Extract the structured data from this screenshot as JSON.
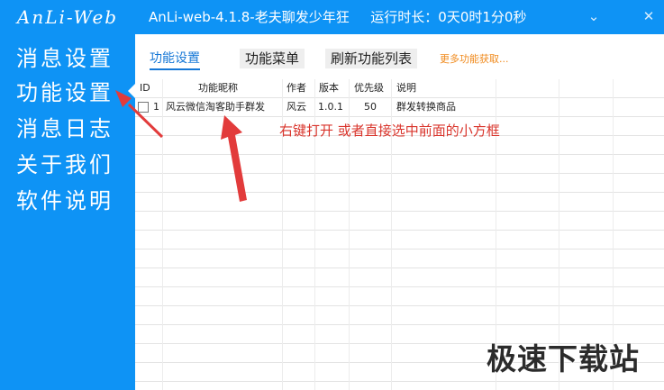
{
  "app": {
    "logo": "AnLi-Web",
    "title": "AnLi-web-4.1.8-老夫聊发少年狂",
    "runtime_label": "运行时长：0天0时1分0秒"
  },
  "window": {
    "minimize_label": "⌄",
    "close_label": "✕"
  },
  "sidebar": {
    "items": [
      {
        "label": "消息设置"
      },
      {
        "label": "功能设置"
      },
      {
        "label": "消息日志"
      },
      {
        "label": "关于我们"
      },
      {
        "label": "软件说明"
      }
    ],
    "active_index": 1
  },
  "tabs": {
    "items": [
      {
        "label": "功能设置"
      },
      {
        "label": "功能菜单"
      },
      {
        "label": "刷新功能列表"
      }
    ],
    "more_link": "更多功能获取..."
  },
  "table": {
    "columns": [
      "ID",
      "功能昵称",
      "作者",
      "版本",
      "优先级",
      "说明"
    ],
    "rows": [
      {
        "id": "1",
        "name": "风云微信淘客助手群发",
        "author": "风云",
        "version": "1.0.1",
        "priority": "50",
        "description": "群发转换商品",
        "checked": false
      }
    ]
  },
  "hint": "右键打开 或者直接选中前面的小方框",
  "watermark": "极速下载站",
  "colors": {
    "primary": "#0e93f5",
    "tab_active": "#1577d6",
    "more_link": "#f08a1c",
    "hint": "#d9342b"
  }
}
